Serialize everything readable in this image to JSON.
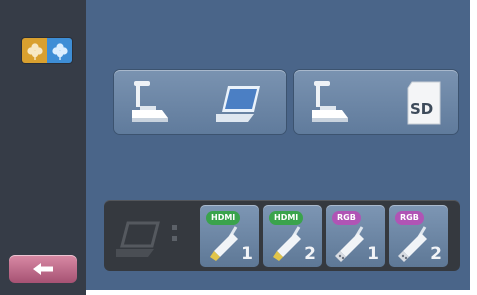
{
  "sidebar": {
    "mode_icon": {
      "left_icon": "clover-icon",
      "right_icon": "snowflake-icon",
      "colors": {
        "warm": "#d9a02f",
        "cool": "#3e8ed6"
      }
    },
    "back_button": {
      "icon": "arrow-left-icon",
      "color": "#a65273"
    }
  },
  "main": {
    "background": "#4a6589",
    "modes": [
      {
        "name": "camera-to-pc",
        "icons": [
          "document-camera-icon",
          "laptop-icon"
        ]
      },
      {
        "name": "camera-to-sd",
        "icons": [
          "document-camera-icon",
          "sd-card-icon"
        ],
        "sd_label": "SD"
      }
    ],
    "inputs": {
      "source_icon": "laptop-icon",
      "ports": [
        {
          "type": "HDMI",
          "number": "1",
          "badge_color": "#3aa34c"
        },
        {
          "type": "HDMI",
          "number": "2",
          "badge_color": "#3aa34c"
        },
        {
          "type": "RGB",
          "number": "1",
          "badge_color": "#b054b5"
        },
        {
          "type": "RGB",
          "number": "2",
          "badge_color": "#b054b5"
        }
      ]
    }
  }
}
